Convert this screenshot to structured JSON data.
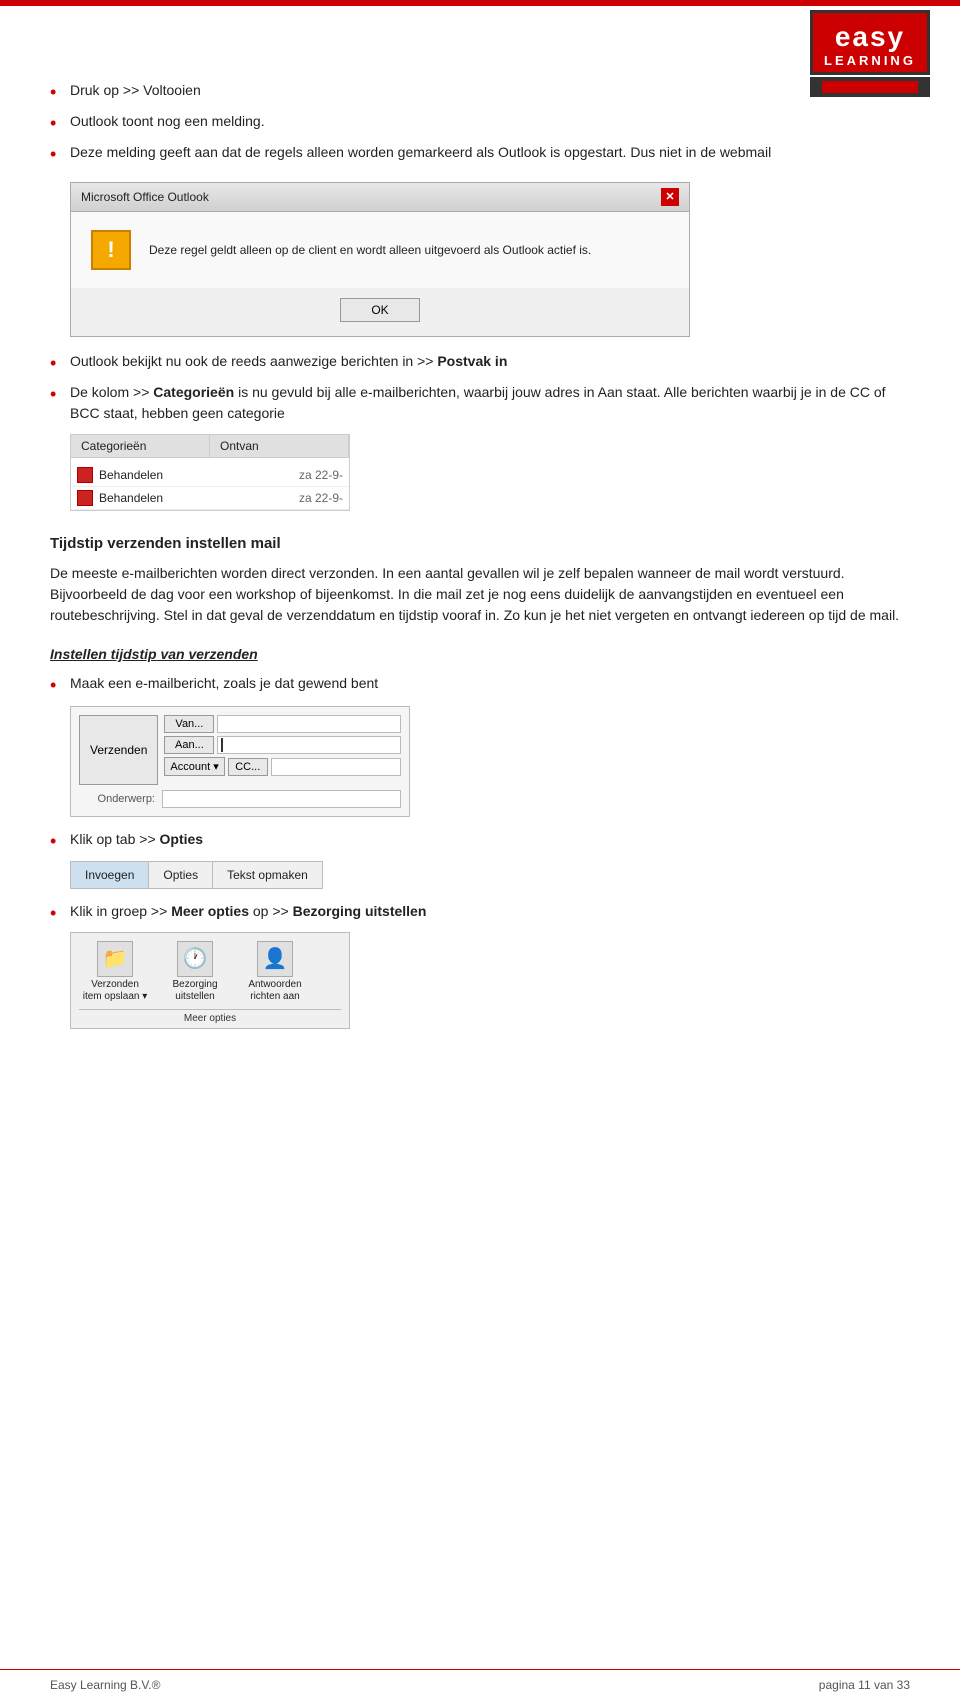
{
  "header": {
    "red_line": true,
    "logo": {
      "easy": "easy",
      "learning": "LEARNING"
    }
  },
  "content": {
    "bullet1": "Druk op >> Voltooien",
    "bullet2": "Outlook toont nog een melding.",
    "bullet3": "Deze melding geeft aan dat de regels alleen worden gemarkeerd als Outlook is opgestart. Dus niet in de webmail",
    "dialog": {
      "title": "Microsoft Office Outlook",
      "close": "✕",
      "message": "Deze regel geldt alleen op de client en wordt alleen uitgevoerd als Outlook actief is.",
      "ok_label": "OK"
    },
    "bullet4_pre": "Outlook bekijkt nu ook de reeds aanwezige berichten in >>",
    "bullet4_bold": "Postvak in",
    "bullet5_pre": "De kolom >>",
    "bullet5_bold": "Categorieën",
    "bullet5_post": "is nu gevuld bij alle e-mailberichten, waarbij jouw adres in Aan staat. Alle berichten waarbij je in de CC of BCC staat, hebben geen categorie",
    "categories": {
      "col1": "Categorieën",
      "col2": "Ontvan",
      "rows": [
        {
          "color": "#cc2222",
          "label": "Behandelen",
          "date": "za 22-9-"
        },
        {
          "color": "#cc2222",
          "label": "Behandelen",
          "date": "za 22-9-"
        }
      ]
    },
    "section_tijdstip": {
      "heading": "Tijdstip verzenden instellen mail",
      "para1": "De meeste e-mailberichten worden direct verzonden. In een aantal gevallen wil je zelf bepalen wanneer de mail wordt verstuurd. Bijvoorbeeld de dag voor een workshop of bijeenkomst. In die mail zet je nog eens duidelijk de aanvangstijden en eventueel een routebeschrijving. Stel in dat geval de verzenddatum en tijdstip vooraf in. Zo kun je het niet vergeten en ontvangt iedereen op tijd de mail."
    },
    "section_instellen": {
      "heading": "Instellen tijdstip van verzenden",
      "bullet1": "Maak een e-mailbericht, zoals je dat gewend bent",
      "compose": {
        "send_btn": "Verzenden",
        "van_btn": "Van...",
        "aan_btn": "Aan...",
        "account_btn": "Account ▾",
        "cc_btn": "CC...",
        "subject_label": "Onderwerp:"
      },
      "bullet2_pre": "Klik op tab >>",
      "bullet2_bold": "Opties",
      "tabs": {
        "items": [
          "Invoegen",
          "Opties",
          "Tekst opmaken"
        ]
      },
      "bullet3_pre": "Klik in groep >>",
      "bullet3_bold1": "Meer opties",
      "bullet3_mid": "op >>",
      "bullet3_bold2": "Bezorging uitstellen",
      "meer_opties": {
        "items": [
          {
            "icon": "📁",
            "label": "Verzonden item opslaan ▾"
          },
          {
            "icon": "🕐",
            "label": "Bezorging uitstellen"
          },
          {
            "icon": "👤",
            "label": "Antwoorden richten aan"
          }
        ],
        "footer": "Meer opties"
      }
    }
  },
  "footer": {
    "company": "Easy Learning B.V.®",
    "page": "pagina 11 van 33"
  }
}
